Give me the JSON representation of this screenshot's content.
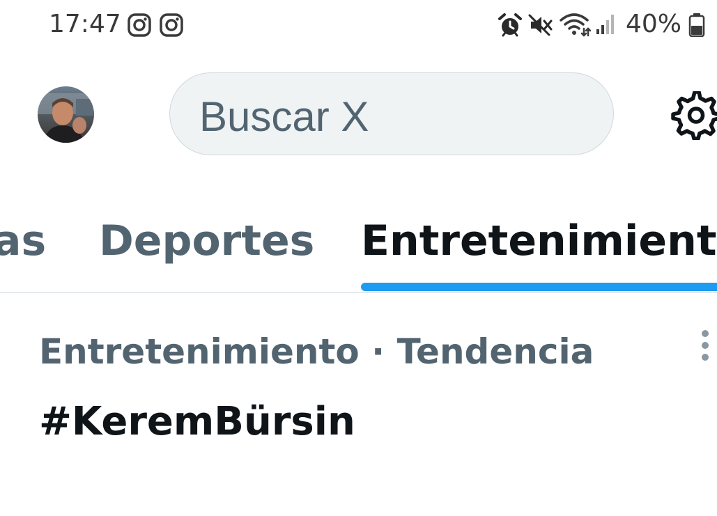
{
  "status_bar": {
    "time": "17:47",
    "battery_percent": "40%",
    "notification_icons": [
      "instagram-icon",
      "instagram-icon"
    ],
    "system_icons": [
      "alarm-icon",
      "mute-icon",
      "wifi-icon",
      "signal-icon",
      "battery-icon"
    ]
  },
  "header": {
    "avatar_icon": "profile-avatar",
    "search": {
      "placeholder": "Buscar X"
    },
    "settings_icon": "gear-icon"
  },
  "tabs": [
    {
      "label": "as",
      "active": false
    },
    {
      "label": "Deportes",
      "active": false
    },
    {
      "label": "Entretenimiento",
      "active": true
    }
  ],
  "colors": {
    "accent": "#1d9bf0",
    "text_primary": "#0f1419",
    "text_secondary": "#536471",
    "search_bg": "#eff3f4",
    "border": "#cfd9de"
  },
  "trends": [
    {
      "meta": "Entretenimiento · Tendencia",
      "title": "#KeremBürsin"
    }
  ]
}
